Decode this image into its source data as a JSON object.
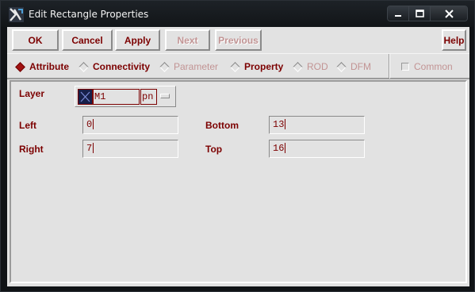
{
  "window": {
    "title": "Edit Rectangle Properties",
    "icon": "app-icon",
    "controls": [
      "minimize-icon",
      "maximize-icon",
      "close-icon"
    ]
  },
  "buttons": {
    "ok": "OK",
    "cancel": "Cancel",
    "apply": "Apply",
    "next": "Next",
    "previous": "Previous",
    "help": "Help"
  },
  "tabs": {
    "attribute": "Attribute",
    "connectivity": "Connectivity",
    "parameter": "Parameter",
    "property": "Property",
    "rod": "ROD",
    "dfm": "DFM",
    "selected": "Attribute"
  },
  "common": {
    "label": "Common",
    "checked": false
  },
  "form": {
    "layer": {
      "label": "Layer",
      "name": "M1",
      "purpose": "pn"
    },
    "left": {
      "label": "Left",
      "value": "0"
    },
    "bottom": {
      "label": "Bottom",
      "value": "13"
    },
    "right": {
      "label": "Right",
      "value": "7"
    },
    "top": {
      "label": "Top",
      "value": "16"
    }
  },
  "colors": {
    "label": "#7c0000",
    "disabled": "#c29494",
    "background": "#e2e2e2",
    "layer_swatch": "#17204a"
  }
}
